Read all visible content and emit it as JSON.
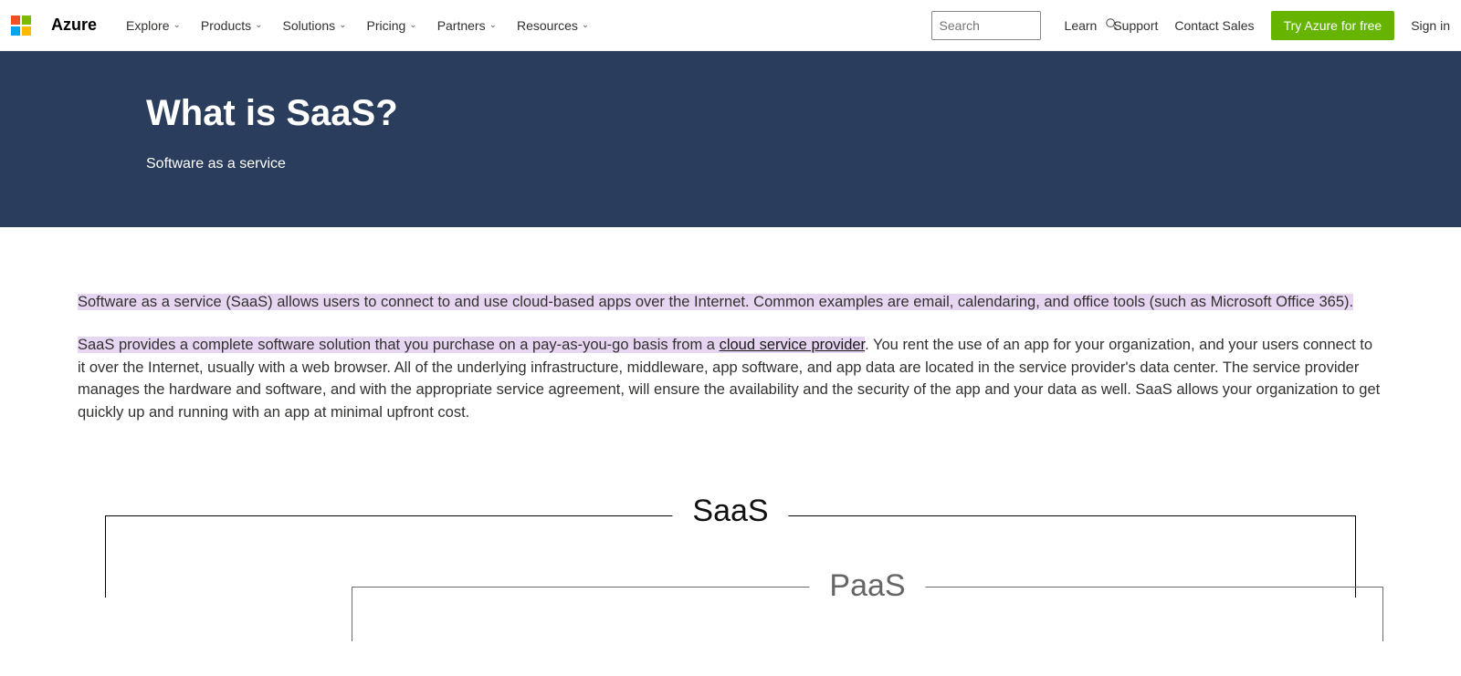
{
  "nav": {
    "brand": "Azure",
    "primary": [
      {
        "label": "Explore"
      },
      {
        "label": "Products"
      },
      {
        "label": "Solutions"
      },
      {
        "label": "Pricing"
      },
      {
        "label": "Partners"
      },
      {
        "label": "Resources"
      }
    ],
    "search_placeholder": "Search",
    "secondary": {
      "learn": "Learn",
      "support": "Support",
      "contact": "Contact Sales",
      "cta": "Try Azure for free",
      "signin": "Sign in"
    }
  },
  "hero": {
    "title": "What is SaaS?",
    "subtitle": "Software as a service"
  },
  "body": {
    "p1": "Software as a service (SaaS) allows users to connect to and use cloud-based apps over the Internet. Common examples are email, calendaring, and office tools (such as Microsoft Office 365).",
    "p2_hl": "SaaS provides a complete software solution that you purchase on a pay-as-you-go basis from a ",
    "p2_link": "cloud service provider",
    "p2_rest": ". You rent the use of an app for your organization, and your users connect to it over the Internet, usually with a web browser. All of the underlying infrastructure, middleware, app software, and app data are located in the service provider's data center. The service provider manages the hardware and software, and with the appropriate service agreement, will ensure the availability and the security of the app and your data as well. SaaS allows your organization to get quickly up and running with an app at minimal upfront cost."
  },
  "diagram": {
    "saas": "SaaS",
    "paas": "PaaS"
  }
}
